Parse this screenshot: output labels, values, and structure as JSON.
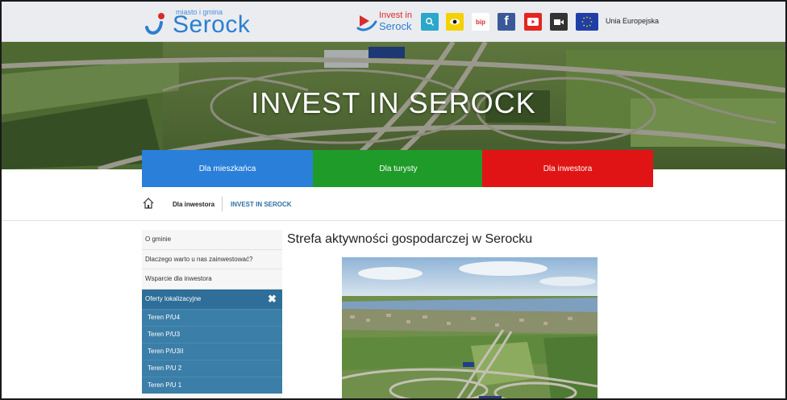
{
  "header": {
    "logo_small": "miasto i gmina",
    "logo_name": "Serock",
    "invest_line1": "Invest in",
    "invest_line2": "Serock",
    "bip_label": "bip",
    "eu_label": "Unia Europejska",
    "icons": [
      "search-icon",
      "eye-icon",
      "bip-icon",
      "facebook-icon",
      "youtube-icon",
      "video-camera-icon",
      "eu-flag-icon"
    ]
  },
  "hero": {
    "title": "INVEST IN SEROCK"
  },
  "tiles": [
    {
      "label": "Dla mieszkańca",
      "color": "#2a7fd8"
    },
    {
      "label": "Dla turysty",
      "color": "#1f9b2a"
    },
    {
      "label": "Dla inwestora",
      "color": "#e01414"
    }
  ],
  "breadcrumb": {
    "item1": "Dla inwestora",
    "item2": "INVEST IN SEROCK"
  },
  "sidebar": {
    "items": [
      {
        "label": "O gminie"
      },
      {
        "label": "Dlaczego warto u nas zainwestować?"
      },
      {
        "label": "Wsparcie dla inwestora"
      }
    ],
    "active": {
      "label": "Oferty lokalizacyjne"
    },
    "subitems": [
      {
        "label": "Teren P/U4"
      },
      {
        "label": "Teren P/U3"
      },
      {
        "label": "Teren P/U3II"
      },
      {
        "label": "Teren P/U 2"
      },
      {
        "label": "Teren P/U 1"
      }
    ]
  },
  "main": {
    "title": "Strefa aktywności gospodarczej w Serocku"
  },
  "colors": {
    "accent": "#2a7fd0",
    "sidebar_active": "#2e6e98",
    "sidebar_sub": "#3b7ea8"
  }
}
